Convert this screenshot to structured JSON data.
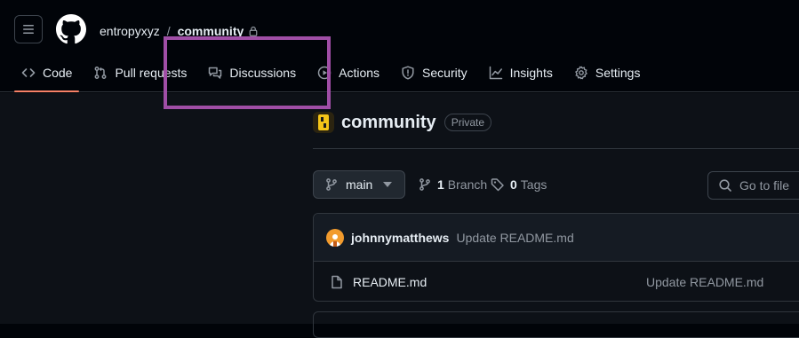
{
  "header": {
    "owner": "entropyxyz",
    "separator": "/",
    "repo": "community"
  },
  "tabs": [
    {
      "label": "Code",
      "icon": "code-icon",
      "selected": true
    },
    {
      "label": "Pull requests",
      "icon": "pull-request-icon"
    },
    {
      "label": "Discussions",
      "icon": "discussions-icon"
    },
    {
      "label": "Actions",
      "icon": "play-icon"
    },
    {
      "label": "Security",
      "icon": "shield-icon"
    },
    {
      "label": "Insights",
      "icon": "graph-icon"
    },
    {
      "label": "Settings",
      "icon": "gear-icon"
    }
  ],
  "repo_header": {
    "title": "community",
    "visibility": "Private"
  },
  "toolbar": {
    "branch": "main",
    "branches_count": "1",
    "branches_label": "Branch",
    "tags_count": "0",
    "tags_label": "Tags",
    "goto_file": "Go to file"
  },
  "latest_commit": {
    "author": "johnnymatthews",
    "message": "Update README.md"
  },
  "files": [
    {
      "name": "README.md",
      "commit_message": "Update README.md"
    }
  ],
  "colors": {
    "background": "#010409",
    "tab_underline": "#f78166",
    "highlight_box": "#a04ea6"
  }
}
